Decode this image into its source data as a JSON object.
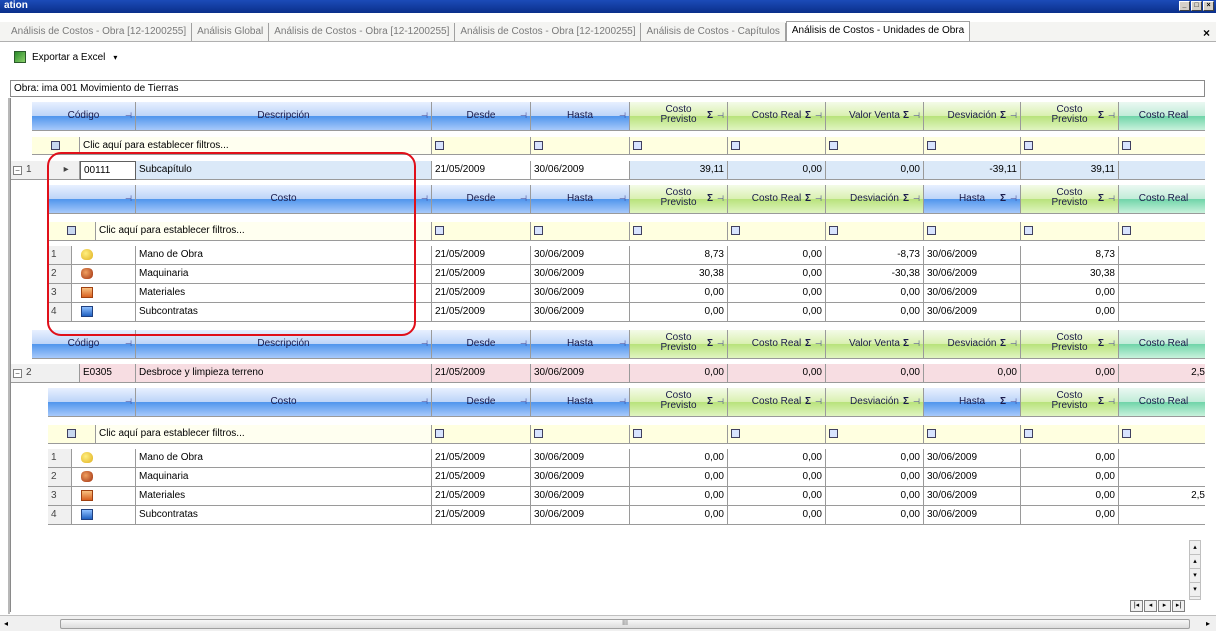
{
  "window": {
    "title": "ation",
    "buttons": [
      "_",
      "□",
      "×"
    ]
  },
  "tabs": [
    {
      "label": "Análisis de Costos - Obra [12-1200255]",
      "active": false
    },
    {
      "label": "Análisis Global",
      "active": false
    },
    {
      "label": "Análisis de Costos - Obra [12-1200255]",
      "active": false
    },
    {
      "label": "Análisis de Costos - Obra [12-1200255]",
      "active": false
    },
    {
      "label": "Análisis de Costos - Capítulos",
      "active": false
    },
    {
      "label": "Análisis de Costos - Unidades de Obra",
      "active": true
    }
  ],
  "tab_close": "×",
  "toolbar": {
    "export_label": "Exportar a Excel",
    "dropdown": "▾"
  },
  "obra_label": "Obra: ima 001 Movimiento de Tierras",
  "grid": {
    "headers_main": {
      "codigo": "Código",
      "descripcion": "Descripción",
      "desde": "Desde",
      "hasta": "Hasta",
      "costo_previsto_1": "Costo",
      "costo_previsto_2": "Previsto",
      "costo_real": "Costo Real",
      "valor_venta": "Valor Venta",
      "desviacion": "Desviación",
      "costo_real2": "Costo Real"
    },
    "headers_sub": {
      "costo": "Costo",
      "desde": "Desde",
      "hasta": "Hasta",
      "costo_previsto_1": "Costo",
      "costo_previsto_2": "Previsto",
      "costo_real": "Costo Real",
      "desviacion": "Desviación",
      "hasta2": "Hasta",
      "costo_real2": "Costo Real"
    },
    "sigma": "Σ",
    "pin": "⊣",
    "filter_text": "Clic aquí para establecer filtros...",
    "group1": {
      "row_num": "1",
      "expander": "−",
      "code": "00111",
      "desc": "Subcapítulo",
      "desde": "21/05/2009",
      "hasta": "30/06/2009",
      "costo_previsto": "39,11",
      "costo_real": "0,00",
      "valor_venta": "0,00",
      "desviacion": "-39,11",
      "costo_previsto2": "39,11",
      "items": [
        {
          "num": "1",
          "icon": "mano-obra-icon",
          "desc": "Mano de Obra",
          "desde": "21/05/2009",
          "hasta": "30/06/2009",
          "previsto": "8,73",
          "real": "0,00",
          "desv": "-8,73",
          "hasta2": "30/06/2009",
          "previsto2": "8,73"
        },
        {
          "num": "2",
          "icon": "maquinaria-icon",
          "desc": "Maquinaria",
          "desde": "21/05/2009",
          "hasta": "30/06/2009",
          "previsto": "30,38",
          "real": "0,00",
          "desv": "-30,38",
          "hasta2": "30/06/2009",
          "previsto2": "30,38"
        },
        {
          "num": "3",
          "icon": "materiales-icon",
          "desc": "Materiales",
          "desde": "21/05/2009",
          "hasta": "30/06/2009",
          "previsto": "0,00",
          "real": "0,00",
          "desv": "0,00",
          "hasta2": "30/06/2009",
          "previsto2": "0,00"
        },
        {
          "num": "4",
          "icon": "subcontratas-icon",
          "desc": "Subcontratas",
          "desde": "21/05/2009",
          "hasta": "30/06/2009",
          "previsto": "0,00",
          "real": "0,00",
          "desv": "0,00",
          "hasta2": "30/06/2009",
          "previsto2": "0,00"
        }
      ]
    },
    "group2": {
      "row_num": "2",
      "expander": "−",
      "code": "E0305",
      "desc": "Desbroce y limpieza terreno",
      "desde": "21/05/2009",
      "hasta": "30/06/2009",
      "costo_previsto": "0,00",
      "costo_real": "0,00",
      "valor_venta": "0,00",
      "desviacion": "0,00",
      "costo_previsto2": "0,00",
      "costo_real2": "2,5",
      "items": [
        {
          "num": "1",
          "icon": "mano-obra-icon",
          "desc": "Mano de Obra",
          "desde": "21/05/2009",
          "hasta": "30/06/2009",
          "previsto": "0,00",
          "real": "0,00",
          "desv": "0,00",
          "hasta2": "30/06/2009",
          "previsto2": "0,00",
          "real2": ""
        },
        {
          "num": "2",
          "icon": "maquinaria-icon",
          "desc": "Maquinaria",
          "desde": "21/05/2009",
          "hasta": "30/06/2009",
          "previsto": "0,00",
          "real": "0,00",
          "desv": "0,00",
          "hasta2": "30/06/2009",
          "previsto2": "0,00",
          "real2": ""
        },
        {
          "num": "3",
          "icon": "materiales-icon",
          "desc": "Materiales",
          "desde": "21/05/2009",
          "hasta": "30/06/2009",
          "previsto": "0,00",
          "real": "0,00",
          "desv": "0,00",
          "hasta2": "30/06/2009",
          "previsto2": "0,00",
          "real2": "2,5"
        },
        {
          "num": "4",
          "icon": "subcontratas-icon",
          "desc": "Subcontratas",
          "desde": "21/05/2009",
          "hasta": "30/06/2009",
          "previsto": "0,00",
          "real": "0,00",
          "desv": "0,00",
          "hasta2": "30/06/2009",
          "previsto2": "0,00",
          "real2": ""
        }
      ]
    }
  },
  "scroll": {
    "hthumb_label": "III",
    "left_arrow": "◂",
    "right_arrow": "▸",
    "pager": [
      "|◂",
      "◂",
      "▸",
      "▸|"
    ],
    "vbtns": [
      "▴",
      "▴",
      "▾",
      "▾"
    ]
  }
}
